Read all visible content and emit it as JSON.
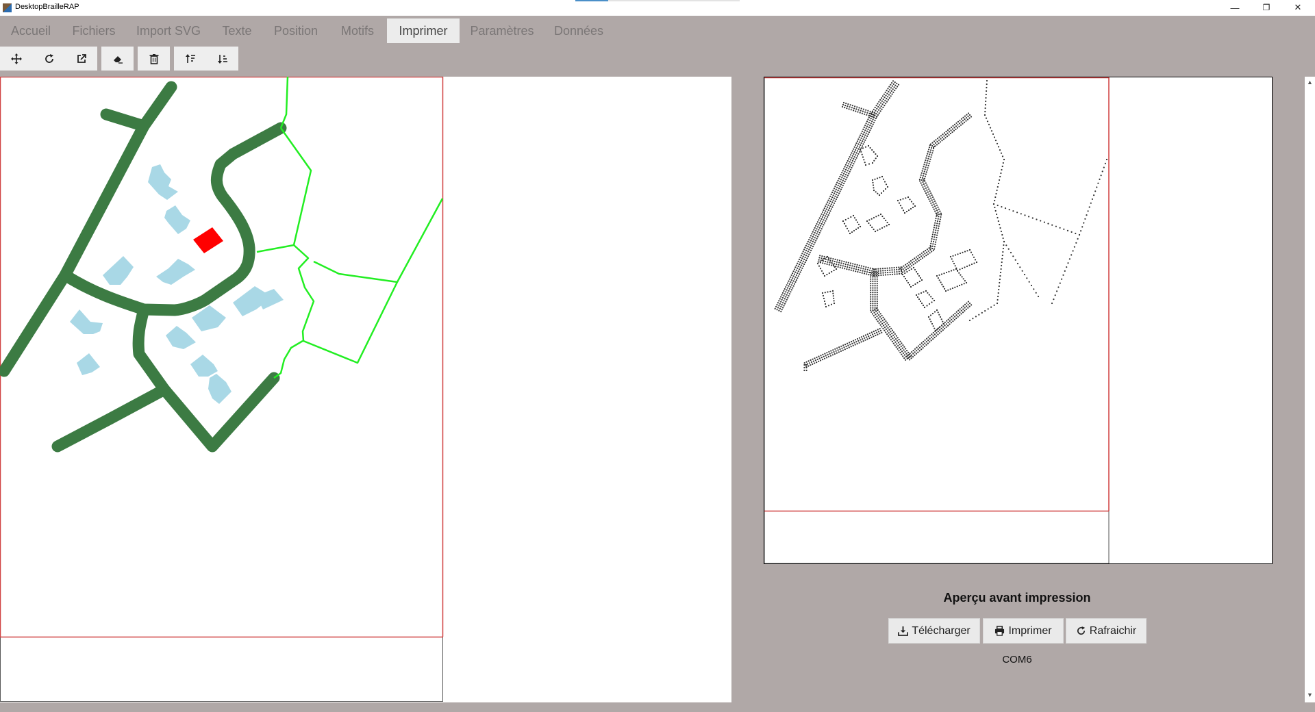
{
  "app": {
    "title": "DesktopBrailleRAP"
  },
  "window_controls": {
    "minimize": "—",
    "restore": "❐",
    "close": "✕"
  },
  "menu": {
    "tabs": [
      "Accueil",
      "Fichiers",
      "Import SVG",
      "Texte",
      "Position",
      "Motifs",
      "Imprimer",
      "Paramètres",
      "Données"
    ],
    "active": "Imprimer"
  },
  "toolbar": {
    "tools": [
      "move-icon",
      "rotate-icon",
      "external-link-icon",
      "eraser-icon",
      "trash-icon",
      "sort-ascending-icon",
      "sort-descending-icon"
    ]
  },
  "preview": {
    "title": "Aperçu avant impression",
    "buttons": {
      "download": "Télécharger",
      "print": "Imprimer",
      "refresh": "Rafraichir"
    },
    "port": "COM6"
  },
  "colors": {
    "road": "#3c7b43",
    "boundary": "#22ee22",
    "building": "#a9d8e6",
    "highlight": "#ff0000",
    "page_border": "#d04040"
  }
}
